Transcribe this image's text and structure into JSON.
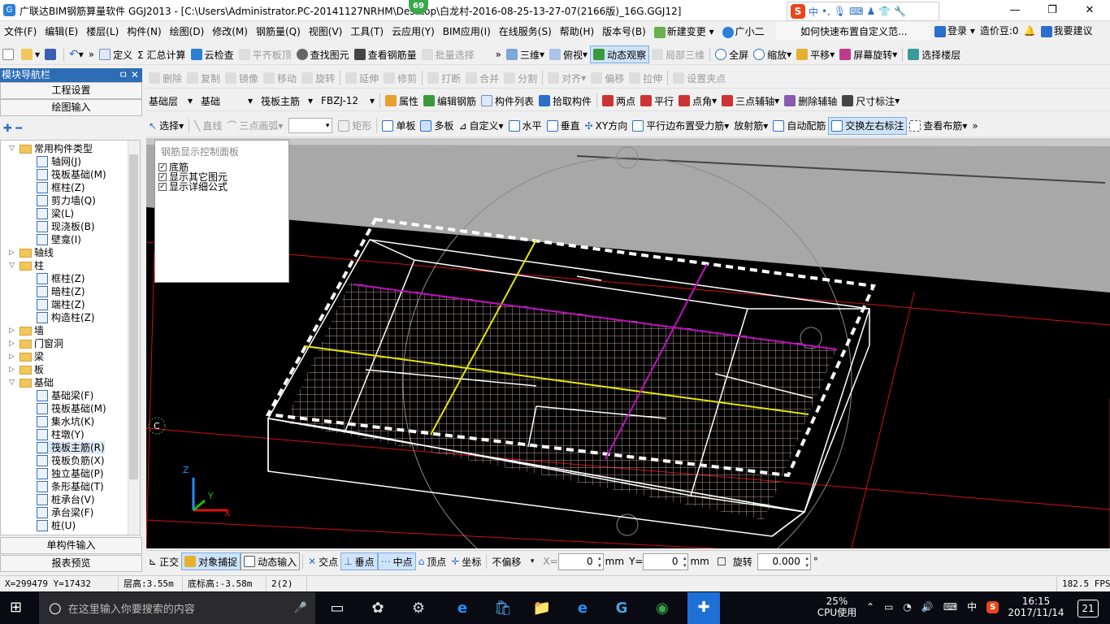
{
  "titlebar": {
    "title": "广联达BIM钢筋算量软件 GGJ2013 - [C:\\Users\\Administrator.PC-20141127NRHM\\Desktop\\白龙村-2016-08-25-13-27-07(2166版)_16G.GGJ12]",
    "badge": "69",
    "minimize": "—",
    "maximize": "❐",
    "close": "✕"
  },
  "ime": {
    "logo": "S",
    "lang": "中",
    "punct": "•,",
    "icons": [
      "mic-icon",
      "keyboard-icon",
      "user-icon",
      "shirt-icon",
      "wrench-icon"
    ]
  },
  "menubar": {
    "items": [
      "文件(F)",
      "编辑(E)",
      "楼层(L)",
      "构件(N)",
      "绘图(D)",
      "修改(M)",
      "钢筋量(Q)",
      "视图(V)",
      "工具(T)",
      "云应用(Y)",
      "BIM应用(I)",
      "在线服务(S)",
      "帮助(H)",
      "版本号(B)"
    ],
    "new_change": "新建变更",
    "xiaoer": "广小二",
    "help_text": "如何快速布置自定义范...",
    "login": "登录",
    "zaojia": "造价豆:0",
    "complaint": "我要建议"
  },
  "toolbar1": {
    "define": "定义",
    "sum": "Σ 汇总计算",
    "cloud_check": "云检查",
    "align_top": "平齐板顶",
    "find": "查找图元",
    "view_rebar": "查看钢筋量",
    "batch": "批量选择",
    "view3d": "三维",
    "top_view": "俯视",
    "dynamic": "动态观察",
    "local3d": "局部三维",
    "fullscreen": "全屏",
    "zoom": "缩放",
    "pan": "平移",
    "rotate": "屏幕旋转",
    "select_floor": "选择楼层"
  },
  "toolbar2": {
    "delete": "删除",
    "copy": "复制",
    "mirror": "镜像",
    "move": "移动",
    "rotate": "旋转",
    "extend": "延伸",
    "trim": "修剪",
    "break": "打断",
    "merge": "合并",
    "split": "分割",
    "align": "对齐",
    "offset": "偏移",
    "stretch": "拉伸",
    "set_node": "设置夹点"
  },
  "toolbar3": {
    "floor_label": "基础层",
    "floor_type": "基础",
    "component_type": "筏板主筋",
    "component_name": "FBZJ-12",
    "property": "属性",
    "edit_rebar": "编辑钢筋",
    "component_list": "构件列表",
    "pick": "拾取构件",
    "two_point": "两点",
    "parallel": "平行",
    "point_angle": "点角",
    "three_point_aux": "三点辅轴",
    "delete_aux": "删除辅轴",
    "dimension": "尺寸标注"
  },
  "toolbar4": {
    "select": "选择",
    "line": "直线",
    "arc": "三点画弧",
    "combo_value": "",
    "rect": "矩形",
    "single": "单板",
    "multi": "多板",
    "custom": "自定义",
    "horizontal": "水平",
    "vertical": "垂直",
    "xy": "XY方向",
    "parallel_edge": "平行边布置受力筋",
    "radial": "放射筋",
    "auto": "自动配筋",
    "swap": "交换左右标注",
    "view_layout": "查看布筋"
  },
  "nav": {
    "header": "模块导航栏",
    "pin": "ㅁ ✕",
    "engineering": "工程设置",
    "drawing_input": "绘图输入",
    "single_input": "单构件输入",
    "report": "报表预览"
  },
  "tree": [
    {
      "label": "常用构件类型",
      "level": 0,
      "type": "folder",
      "open": true
    },
    {
      "label": "轴网(J)",
      "level": 1,
      "type": "item"
    },
    {
      "label": "筏板基础(M)",
      "level": 1,
      "type": "item"
    },
    {
      "label": "框柱(Z)",
      "level": 1,
      "type": "item"
    },
    {
      "label": "剪力墙(Q)",
      "level": 1,
      "type": "item"
    },
    {
      "label": "梁(L)",
      "level": 1,
      "type": "item"
    },
    {
      "label": "现浇板(B)",
      "level": 1,
      "type": "item"
    },
    {
      "label": "壁龛(I)",
      "level": 1,
      "type": "item"
    },
    {
      "label": "轴线",
      "level": 0,
      "type": "folder",
      "open": false
    },
    {
      "label": "柱",
      "level": 0,
      "type": "folder",
      "open": true
    },
    {
      "label": "框柱(Z)",
      "level": 1,
      "type": "item"
    },
    {
      "label": "暗柱(Z)",
      "level": 1,
      "type": "item"
    },
    {
      "label": "端柱(Z)",
      "level": 1,
      "type": "item"
    },
    {
      "label": "构造柱(Z)",
      "level": 1,
      "type": "item"
    },
    {
      "label": "墙",
      "level": 0,
      "type": "folder",
      "open": false
    },
    {
      "label": "门窗洞",
      "level": 0,
      "type": "folder",
      "open": false
    },
    {
      "label": "梁",
      "level": 0,
      "type": "folder",
      "open": false
    },
    {
      "label": "板",
      "level": 0,
      "type": "folder",
      "open": false
    },
    {
      "label": "基础",
      "level": 0,
      "type": "folder",
      "open": true
    },
    {
      "label": "基础梁(F)",
      "level": 1,
      "type": "item"
    },
    {
      "label": "筏板基础(M)",
      "level": 1,
      "type": "item"
    },
    {
      "label": "集水坑(K)",
      "level": 1,
      "type": "item"
    },
    {
      "label": "柱墩(Y)",
      "level": 1,
      "type": "item"
    },
    {
      "label": "筏板主筋(R)",
      "level": 1,
      "type": "item",
      "selected": true
    },
    {
      "label": "筏板负筋(X)",
      "level": 1,
      "type": "item"
    },
    {
      "label": "独立基础(P)",
      "level": 1,
      "type": "item"
    },
    {
      "label": "条形基础(T)",
      "level": 1,
      "type": "item"
    },
    {
      "label": "桩承台(V)",
      "level": 1,
      "type": "item"
    },
    {
      "label": "承台梁(F)",
      "level": 1,
      "type": "item"
    },
    {
      "label": "桩(U)",
      "level": 1,
      "type": "item"
    }
  ],
  "panel": {
    "title": "钢筋显示控制面板",
    "options": [
      {
        "label": "底筋",
        "checked": true
      },
      {
        "label": "显示其它图元",
        "checked": true
      },
      {
        "label": "显示详细公式",
        "checked": true
      }
    ]
  },
  "viewport": {
    "marker": "C",
    "axis_x": "X",
    "axis_y": "Y",
    "axis_z": "Z"
  },
  "snapbar": {
    "ortho": "正交",
    "snap": "对象捕捉",
    "dyn_input": "动态输入",
    "intersection": "交点",
    "perpendicular": "垂点",
    "midpoint": "中点",
    "vertex": "顶点",
    "coord": "坐标",
    "offset_mode": "不偏移",
    "x_label": "X=",
    "x_value": "0",
    "unit1": "mm",
    "y_label": "Y=",
    "y_value": "0",
    "unit2": "mm",
    "rotate_label": "旋转",
    "rotate_value": "0.000",
    "degree": "°"
  },
  "status": {
    "coords": "X=299479 Y=17432",
    "floor_height": "层高:3.55m",
    "base_height": "底标高:-3.58m",
    "count": "2(2)",
    "fps": "182.5 FPS"
  },
  "taskbar": {
    "search_placeholder": "在这里输入你要搜索的内容",
    "cpu_percent": "25%",
    "cpu_label": "CPU使用",
    "lang": "中",
    "time": "16:15",
    "date": "2017/11/14",
    "notif": "21"
  },
  "colors": {
    "accent": "#2d6db5",
    "grid": "#c8a8a8",
    "axis_red": "#d01010",
    "yellow": "#e6e600",
    "magenta": "#c010c0"
  }
}
